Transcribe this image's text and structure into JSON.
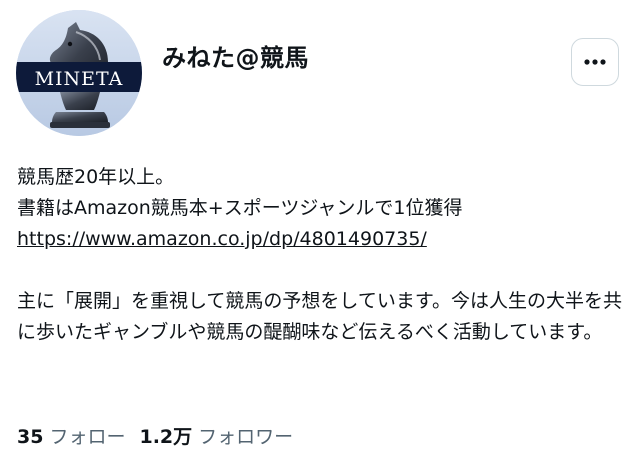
{
  "profile": {
    "display_name": "みねた@競馬",
    "avatar_logo_text": "MINETA",
    "more_icon": "more-horizontal-icon"
  },
  "bio": {
    "line1": "競馬歴20年以上。",
    "line2": "書籍はAmazon競馬本+スポーツジャンルで1位獲得",
    "link": "https://www.amazon.co.jp/dp/4801490735/",
    "paragraph": "主に「展開」を重視して競馬の予想をしています。今は人生の大半を共に歩いたギャンブルや競馬の醍醐味など伝えるべく活動しています。"
  },
  "stats": {
    "following_count": "35",
    "following_label": "フォロー",
    "followers_count": "1.2万",
    "followers_label": "フォロワー"
  },
  "colors": {
    "text": "#0f1419",
    "secondary_text": "#536471",
    "border": "#cfd9de",
    "avatar_band": "#0d1a3a"
  }
}
